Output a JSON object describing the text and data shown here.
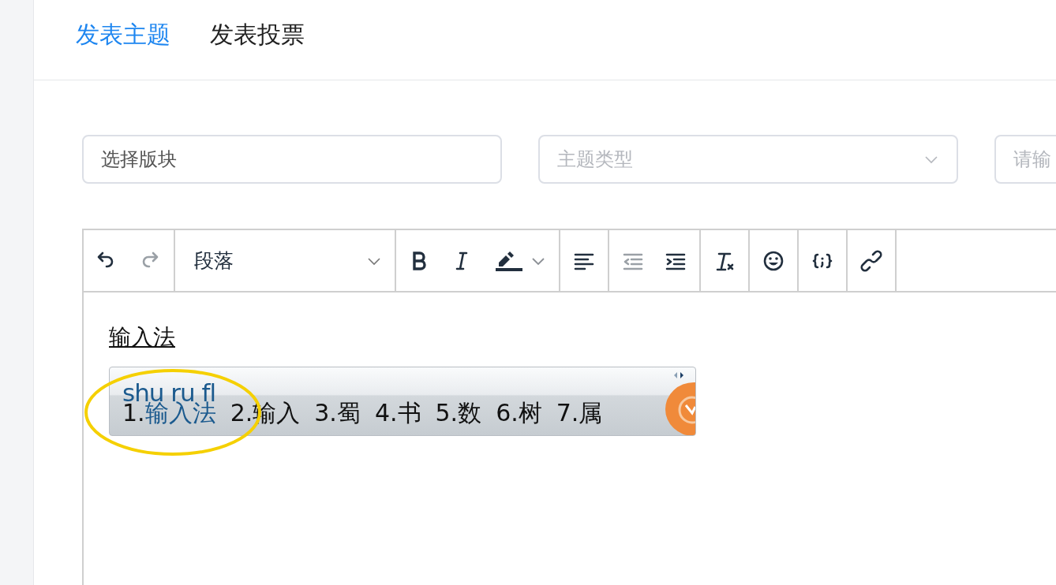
{
  "tabs": [
    {
      "label": "发表主题",
      "selected": true
    },
    {
      "label": "发表投票",
      "selected": false
    }
  ],
  "fields": [
    {
      "kind": "text",
      "value": "选择版块"
    },
    {
      "kind": "select",
      "placeholder": "主题类型"
    },
    {
      "kind": "text",
      "placeholder": "请输"
    }
  ],
  "toolbar": [
    [
      {
        "kind": "undo",
        "disabled": false
      },
      {
        "kind": "redo",
        "disabled": true
      }
    ],
    [
      {
        "kind": "paragraph",
        "label": "段落"
      }
    ],
    [
      {
        "kind": "bold",
        "disabled": false
      },
      {
        "kind": "italic",
        "disabled": false
      },
      {
        "kind": "highlight",
        "disabled": false
      }
    ],
    [
      {
        "kind": "align-left",
        "disabled": false
      }
    ],
    [
      {
        "kind": "outdent",
        "disabled": true
      },
      {
        "kind": "indent",
        "disabled": false
      }
    ],
    [
      {
        "kind": "clear-format",
        "disabled": false
      }
    ],
    [
      {
        "kind": "emoji",
        "disabled": false
      }
    ],
    [
      {
        "kind": "code",
        "disabled": false
      }
    ],
    [
      {
        "kind": "link",
        "disabled": false
      }
    ]
  ],
  "editor": {
    "text": "输入法"
  },
  "ime": {
    "pinyin": "shu ru fl",
    "candidates": [
      {
        "number": "1.",
        "text": "输入法",
        "selected": true
      },
      {
        "number": "2.",
        "text": "输入",
        "selected": false
      },
      {
        "number": "3.",
        "text": "蜀",
        "selected": false
      },
      {
        "number": "4.",
        "text": "书",
        "selected": false
      },
      {
        "number": "5.",
        "text": "数",
        "selected": false
      },
      {
        "number": "6.",
        "text": "树",
        "selected": false
      },
      {
        "number": "7.",
        "text": "属",
        "selected": false
      }
    ]
  }
}
